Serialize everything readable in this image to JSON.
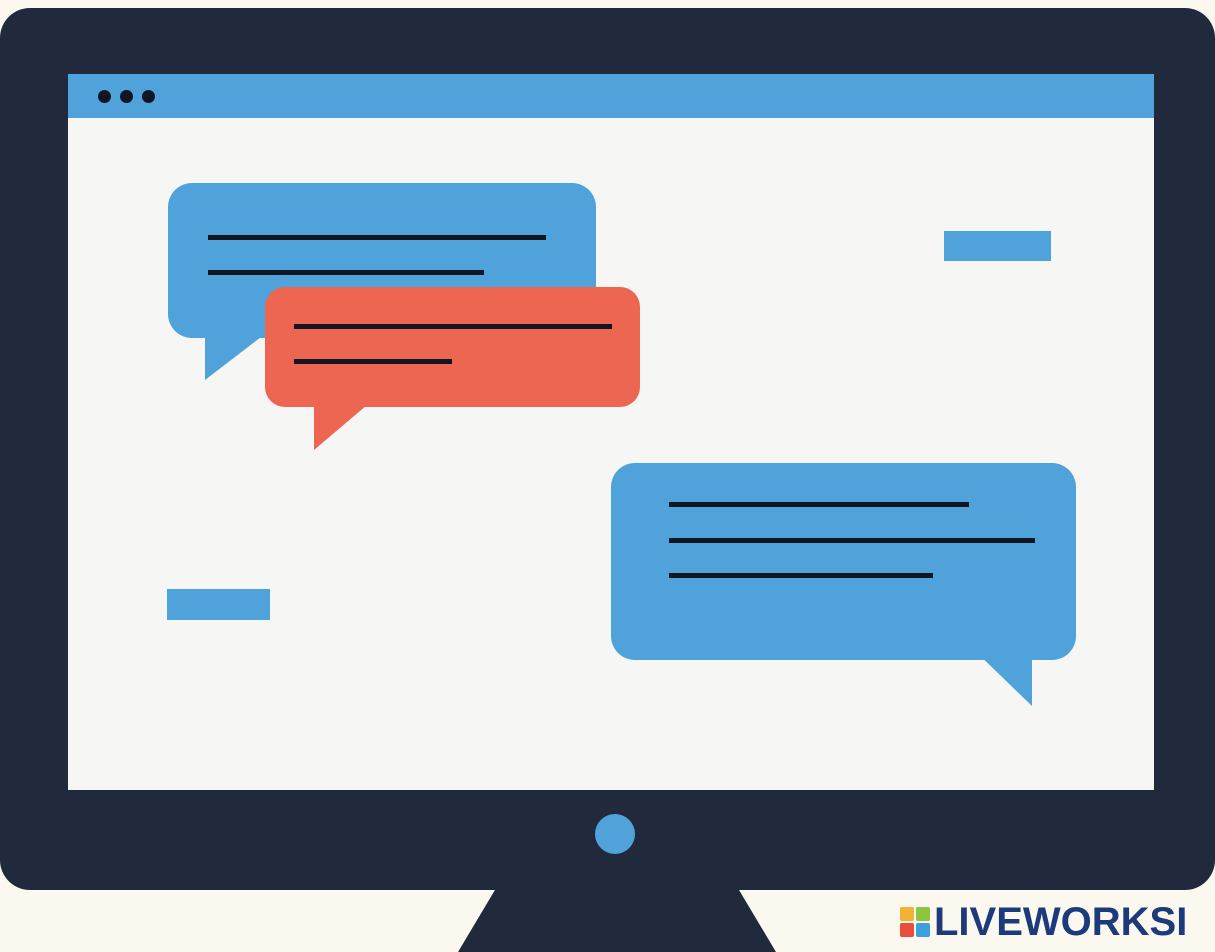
{
  "illustration": {
    "subject": "monitor-with-chat-bubbles",
    "colors": {
      "background": "#fbf8ef",
      "monitor": "#202a3c",
      "screen": "#f6f6f4",
      "accent_blue": "#4fa3da",
      "accent_red": "#ec6652",
      "text_lines": "#111622"
    },
    "titlebar": {
      "dots": [
        "dot",
        "dot",
        "dot"
      ]
    }
  },
  "watermark": {
    "text": "LIVEWORKSI",
    "logo_icon": "liveworksheets-logo-icon",
    "logo_colors": [
      "#f2b233",
      "#8cc63f",
      "#e84e3b",
      "#3aa1dc"
    ]
  }
}
